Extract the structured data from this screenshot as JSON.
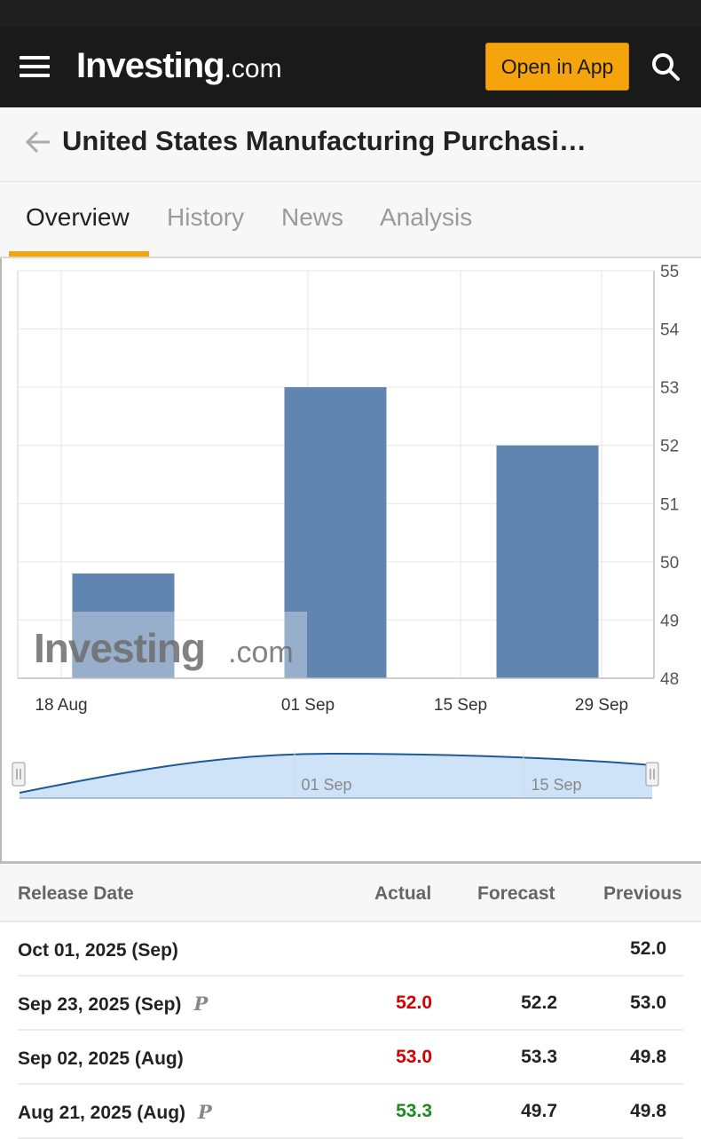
{
  "header": {
    "logo_main": "Investing",
    "logo_suffix": ".com",
    "open_app_label": "Open in App"
  },
  "page": {
    "title": "United States Manufacturing Purchasi…"
  },
  "tabs": [
    {
      "label": "Overview",
      "active": true
    },
    {
      "label": "History",
      "active": false
    },
    {
      "label": "News",
      "active": false
    },
    {
      "label": "Analysis",
      "active": false
    }
  ],
  "chart_data": {
    "type": "bar",
    "categories": [
      "18 Aug",
      "01 Sep",
      "15 Sep",
      "29 Sep"
    ],
    "values": [
      49.8,
      53.0,
      null,
      52.0
    ],
    "ylim": [
      48,
      55
    ],
    "y_ticks": [
      "55",
      "54",
      "53",
      "52",
      "51",
      "50",
      "49",
      "48"
    ],
    "x_ticks": [
      "18 Aug",
      "01 Sep",
      "15 Sep",
      "29 Sep"
    ],
    "navigator_labels": [
      "01 Sep",
      "15 Sep"
    ],
    "watermark": "Investing.com",
    "bar_color": "#6185b1",
    "grid": true,
    "y_axis_position": "right"
  },
  "table": {
    "headers": {
      "date": "Release Date",
      "actual": "Actual",
      "forecast": "Forecast",
      "previous": "Previous"
    },
    "rows": [
      {
        "date": "Oct 01, 2025 (Sep)",
        "prelim": "",
        "actual": "",
        "actual_color": "",
        "forecast": "",
        "previous": "52.0"
      },
      {
        "date": "Sep 23, 2025 (Sep)",
        "prelim": "P",
        "actual": "52.0",
        "actual_color": "red",
        "forecast": "52.2",
        "previous": "53.0"
      },
      {
        "date": "Sep 02, 2025 (Aug)",
        "prelim": "",
        "actual": "53.0",
        "actual_color": "red",
        "forecast": "53.3",
        "previous": "49.8"
      },
      {
        "date": "Aug 21, 2025 (Aug)",
        "prelim": "P",
        "actual": "53.3",
        "actual_color": "green",
        "forecast": "49.7",
        "previous": "49.8"
      }
    ]
  }
}
